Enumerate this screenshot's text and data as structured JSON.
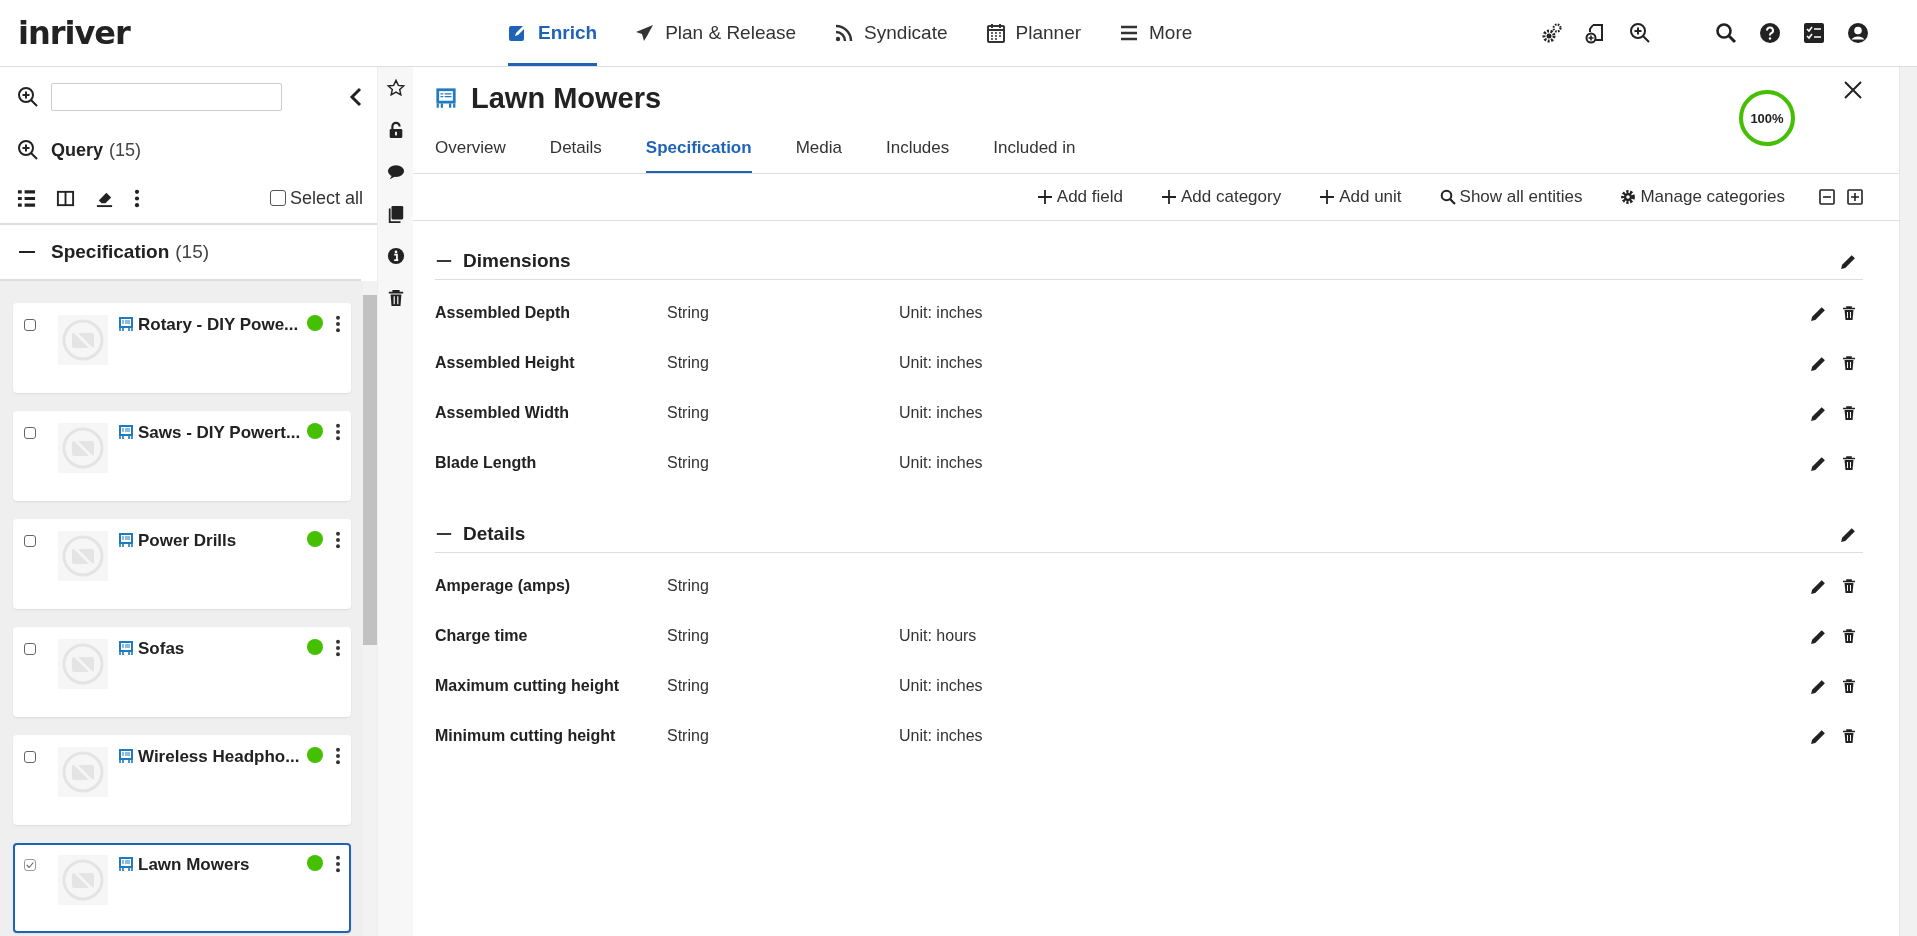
{
  "app": {
    "logo": "inriver"
  },
  "nav": [
    {
      "label": "Enrich",
      "selected": true
    },
    {
      "label": "Plan & Release",
      "selected": false
    },
    {
      "label": "Syndicate",
      "selected": false
    },
    {
      "label": "Planner",
      "selected": false
    },
    {
      "label": "More",
      "selected": false
    }
  ],
  "left_panel": {
    "query_label": "Query",
    "query_count": "(15)",
    "select_all": {
      "label": "Select all",
      "checked": false
    },
    "group": {
      "title": "Specification",
      "count": "(15)",
      "expanded": true
    },
    "items": [
      {
        "name": "Rotary - DIY Powe...",
        "checked": false,
        "selected": false,
        "color": "#44c000"
      },
      {
        "name": "Saws - DIY Powert...",
        "checked": false,
        "selected": false,
        "color": "#44c000"
      },
      {
        "name": "Power Drills",
        "checked": false,
        "selected": false,
        "color": "#44c000"
      },
      {
        "name": "Sofas",
        "checked": false,
        "selected": false,
        "color": "#44c000"
      },
      {
        "name": "Wireless Headpho...",
        "checked": false,
        "selected": false,
        "color": "#44c000"
      },
      {
        "name": "Lawn Mowers",
        "checked": true,
        "selected": true,
        "color": "#44c000"
      }
    ]
  },
  "entity": {
    "title": "Lawn Mowers",
    "completeness": {
      "label": "100%",
      "level": 1
    },
    "tabs": [
      {
        "label": "Overview",
        "selected": false
      },
      {
        "label": "Details",
        "selected": false
      },
      {
        "label": "Specification",
        "selected": true
      },
      {
        "label": "Media",
        "selected": false
      },
      {
        "label": "Includes",
        "selected": false
      },
      {
        "label": "Included in",
        "selected": false
      }
    ]
  },
  "toolbar": [
    "Add field",
    "Add category",
    "Add unit",
    "Show all entities",
    "Manage categories"
  ],
  "sections": [
    {
      "title": "Dimensions",
      "expanded": true,
      "fields": [
        {
          "name": "Assembled Depth",
          "type": "String",
          "unit": "Unit: inches"
        },
        {
          "name": "Assembled Height",
          "type": "String",
          "unit": "Unit: inches"
        },
        {
          "name": "Assembled Width",
          "type": "String",
          "unit": "Unit: inches"
        },
        {
          "name": "Blade Length",
          "type": "String",
          "unit": "Unit: inches"
        }
      ]
    },
    {
      "title": "Details",
      "expanded": true,
      "fields": [
        {
          "name": "Amperage (amps)",
          "type": "String"
        },
        {
          "name": "Charge time",
          "type": "String",
          "unit": "Unit: hours"
        },
        {
          "name": "Maximum cutting height",
          "type": "String",
          "unit": "Unit: inches"
        },
        {
          "name": "Minimum cutting height",
          "type": "String",
          "unit": "Unit: inches"
        }
      ]
    }
  ]
}
